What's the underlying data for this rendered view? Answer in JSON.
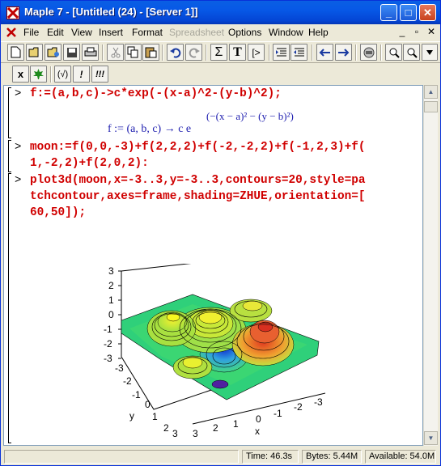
{
  "window": {
    "title": "Maple 7  - [Untitled (24) - [Server 1]]",
    "minimize": "_",
    "maximize": "□",
    "close": "✕"
  },
  "menu": [
    "File",
    "Edit",
    "View",
    "Insert",
    "Format",
    "Spreadsheet",
    "Options",
    "Window",
    "Help"
  ],
  "menu_disabled": [
    "Spreadsheet"
  ],
  "mdi_controls": [
    "_",
    "▫",
    "✕"
  ],
  "toolbar": {
    "icons": [
      "new-document-icon",
      "open-folder-icon",
      "open-url-icon",
      "save-icon",
      "print-icon",
      "cut-icon",
      "copy-icon",
      "paste-icon",
      "undo-icon",
      "redo-icon",
      "sigma-icon",
      "text-icon",
      "exec-icon",
      "indent-icon",
      "outdent-icon",
      "back-arrow-icon",
      "forward-arrow-icon",
      "stop-icon",
      "zoom-in-icon",
      "zoom-out-icon"
    ],
    "sigma": "Σ",
    "text_T": "T",
    "exec": "[>"
  },
  "context_bar": {
    "x_label": "x",
    "paren_label": "(√)",
    "bang_label": "!",
    "bangs_label": "!!!"
  },
  "worksheet": {
    "prompt": ">",
    "input1": "f:=(a,b,c)->c*exp(-(x-a)^2-(y-b)^2);",
    "output1_lhs": "f := (a, b, c) → c e",
    "output1_exp": "(−(x − a)² − (y − b)²)",
    "input2_line1": "moon:=f(0,0,-3)+f(2,2,2)+f(-2,-2,2)+f(-1,2,3)+f(",
    "input2_line2": "1,-2,2)+f(2,0,2):",
    "input3_line1": "plot3d(moon,x=-3..3,y=-3..3,contours=20,style=pa",
    "input3_line2": "tchcontour,axes=frame,shading=ZHUE,orientation=[",
    "input3_line3": "60,50]);"
  },
  "plot": {
    "z_ticks": [
      "3",
      "2",
      "1",
      "0",
      "-1",
      "-2",
      "-3"
    ],
    "y_ticks": [
      "-3",
      "-2",
      "-1",
      "0",
      "1",
      "2",
      "3"
    ],
    "x_ticks": [
      "3",
      "2",
      "1",
      "0",
      "-1",
      "-2",
      "-3"
    ],
    "y_label": "y",
    "x_label": "x"
  },
  "status": {
    "time": "Time:  46.3s",
    "bytes": "Bytes: 5.44M",
    "available": "Available: 54.0M"
  }
}
